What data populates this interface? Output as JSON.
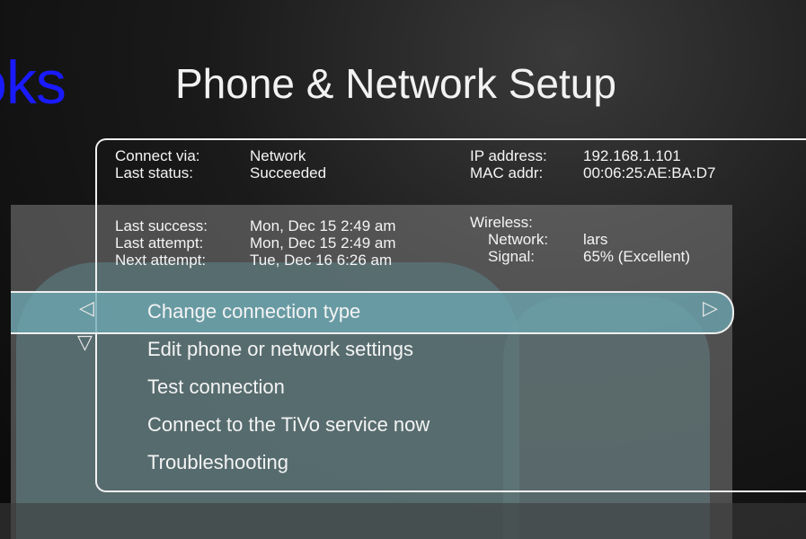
{
  "brand": {
    "text": "oks"
  },
  "header": {
    "title": "Phone & Network Setup"
  },
  "status": {
    "connect_via": {
      "label": "Connect via:",
      "value": "Network"
    },
    "last_status": {
      "label": "Last status:",
      "value": "Succeeded"
    },
    "last_success": {
      "label": "Last success:",
      "value": "Mon, Dec 15 2:49 am"
    },
    "last_attempt": {
      "label": "Last attempt:",
      "value": "Mon, Dec 15 2:49 am"
    },
    "next_attempt": {
      "label": "Next attempt:",
      "value": "Tue, Dec 16 6:26 am"
    },
    "ip_address": {
      "label": "IP address:",
      "value": "192.168.1.101"
    },
    "mac_addr": {
      "label": "MAC addr:",
      "value": "00:06:25:AE:BA:D7"
    },
    "wireless": {
      "label": "Wireless:"
    },
    "network": {
      "label": "Network:",
      "value": "lars"
    },
    "signal": {
      "label": "Signal:",
      "value": "65% (Excellent)"
    }
  },
  "menu": {
    "items": [
      {
        "label": "Change connection type"
      },
      {
        "label": "Edit phone or network settings"
      },
      {
        "label": "Test connection"
      },
      {
        "label": "Connect to the TiVo service now"
      },
      {
        "label": "Troubleshooting"
      }
    ]
  },
  "icons": {
    "left_arrow": "left-triangle-icon",
    "right_arrow": "right-triangle-icon",
    "down_arrow": "down-triangle-icon"
  },
  "colors": {
    "brand": "#1a1aff",
    "highlight": "#6eaab4",
    "text": "#f4f4f4"
  }
}
